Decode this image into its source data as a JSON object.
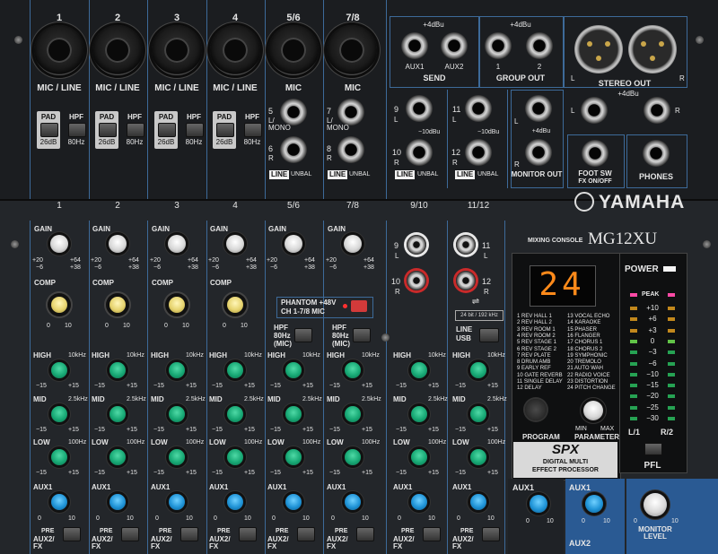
{
  "brand": {
    "name": "YAMAHA",
    "model": "MG12XU",
    "model_prefix": "MIXING CONSOLE"
  },
  "inputs": {
    "channel_numbers": [
      "1",
      "2",
      "3",
      "4",
      "5/6",
      "7/8"
    ],
    "mic_line": "MIC / LINE",
    "mic": "MIC",
    "pad": "PAD",
    "pad_value": "26dB",
    "hpf": "HPF",
    "hpf_value": "80Hz"
  },
  "jacks": {
    "ch5": "5",
    "ch5_sub": "L/\nMONO",
    "ch6": "6",
    "ch6_sub": "R",
    "ch7": "7",
    "ch7_sub": "L/\nMONO",
    "ch8": "8",
    "ch8_sub": "R",
    "ch9": "9",
    "ch9_sub": "L",
    "ch10": "10",
    "ch10_sub": "R",
    "ch11": "11",
    "ch11_sub": "L",
    "ch12": "12",
    "ch12_sub": "R",
    "level_minus10": "−10dBu",
    "line": "LINE",
    "unbal": "UNBAL"
  },
  "send": {
    "level": "+4dBu",
    "aux1": "AUX1",
    "aux2": "AUX2",
    "title": "SEND"
  },
  "group_out": {
    "level": "+4dBu",
    "ch1": "1",
    "ch2": "2",
    "title": "GROUP OUT"
  },
  "stereo_out": {
    "l": "L",
    "r": "R",
    "title": "STEREO OUT",
    "level": "+4dBu"
  },
  "monitor_out": {
    "level": "+4dBu",
    "l": "L",
    "r": "R",
    "title": "MONITOR OUT"
  },
  "foot_sw": {
    "title": "FOOT SW",
    "sub": "FX ON/OFF"
  },
  "phones": {
    "title": "PHONES"
  },
  "strip_numbers": [
    "1",
    "2",
    "3",
    "4",
    "5/6",
    "7/8",
    "9/10",
    "11/12"
  ],
  "gain": {
    "label": "GAIN",
    "min": "+20",
    "max": "+64",
    "min2": "−6",
    "max2": "+38"
  },
  "comp": {
    "label": "COMP",
    "min": "0",
    "max": "10"
  },
  "phantom": {
    "title": "PHANTOM +48V",
    "sub": "CH 1-7/8 MIC"
  },
  "hpf_strip": {
    "title": "HPF",
    "value": "80Hz",
    "sub": "(MIC)"
  },
  "usb": {
    "bits": "24 bit / 192 kHz",
    "line": "LINE",
    "usb": "USB"
  },
  "eq": {
    "high": "HIGH",
    "high_f": "10kHz",
    "mid": "MID",
    "mid_f": "2.5kHz",
    "low": "LOW",
    "low_f": "100Hz",
    "min": "−15",
    "max": "+15"
  },
  "aux": {
    "aux1": "AUX1",
    "aux2fx": "AUX2/\nFX",
    "pre": "PRE",
    "min": "0",
    "max": "10"
  },
  "spx": {
    "display": "24",
    "programs_left": [
      "1 REV HALL 1",
      "2 REV HALL 2",
      "3 REV ROOM 1",
      "4 REV ROOM 2",
      "5 REV STAGE 1",
      "6 REV STAGE 2",
      "7 REV PLATE",
      "8 DRUM AMB",
      "9 EARLY REF",
      "10 GATE REVERB",
      "11 SINGLE DELAY",
      "12 DELAY"
    ],
    "programs_right": [
      "13 VOCAL ECHO",
      "14 KARAOKE",
      "15 PHASER",
      "16 FLANGER",
      "17 CHORUS 1",
      "18 CHORUS 2",
      "19 SYMPHONIC",
      "20 TREMOLO",
      "21 AUTO WAH",
      "22 RADIO VOICE",
      "23 DISTORTION",
      "24 PITCH CHANGE"
    ],
    "program": "PROGRAM",
    "parameter": "PARAMETER",
    "min": "MIN",
    "max": "MAX",
    "logo": "SPX",
    "sub1": "DIGITAL MULTI",
    "sub2": "EFFECT PROCESSOR"
  },
  "meter": {
    "power": "POWER",
    "peak": "PEAK",
    "scale": [
      "+10",
      "+6",
      "+3",
      "0",
      "−3",
      "−6",
      "−10",
      "−15",
      "−20",
      "−25",
      "−30"
    ],
    "l": "L/1",
    "r": "R/2",
    "pfl": "PFL"
  },
  "master": {
    "aux1": "AUX1",
    "aux2": "AUX2",
    "monitor_level": "MONITOR\nLEVEL",
    "min": "0",
    "max": "10"
  }
}
